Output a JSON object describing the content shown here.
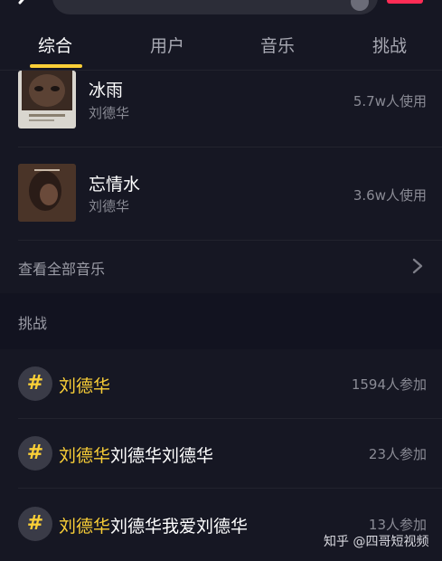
{
  "tabs": [
    "综合",
    "用户",
    "音乐",
    "挑战"
  ],
  "music": [
    {
      "title": "冰雨",
      "artist": "刘德华",
      "usage": "5.7w人使用"
    },
    {
      "title": "忘情水",
      "artist": "刘德华",
      "usage": "3.6w人使用"
    }
  ],
  "see_all_music": "查看全部音乐",
  "challenge_section_title": "挑战",
  "challenges": [
    {
      "highlight": "刘德华",
      "rest": "",
      "participants": "1594人参加"
    },
    {
      "highlight": "刘德华",
      "rest": "刘德华刘德华",
      "participants": "23人参加"
    },
    {
      "highlight": "刘德华",
      "rest": "刘德华我爱刘德华",
      "participants": "13人参加"
    }
  ],
  "watermark": "知乎 @四哥短视频",
  "colors": {
    "background": "#161723",
    "accent_yellow": "#facf37",
    "brand_red": "#fe2c55"
  }
}
